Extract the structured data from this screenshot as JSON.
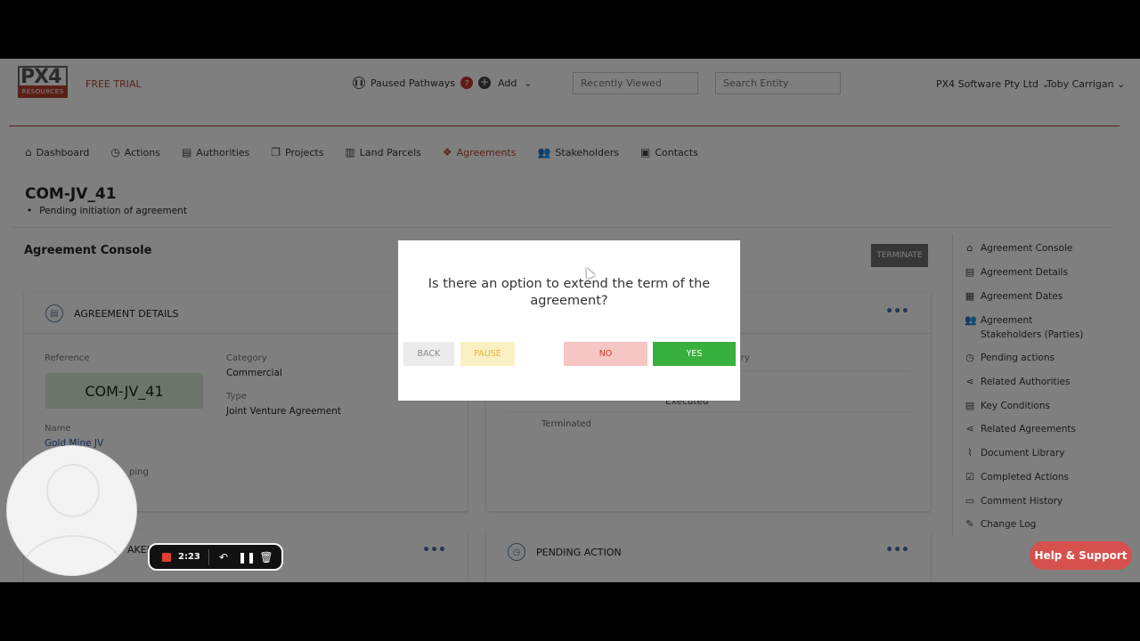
{
  "header": {
    "logo_mark": "PX4",
    "logo_sub": "RESOURCES",
    "free_trial": "FREE TRIAL",
    "paused_pathways_label": "Paused Pathways",
    "paused_count": "7",
    "add_label": "Add",
    "recently_viewed_placeholder": "Recently Viewed",
    "search_placeholder": "Search Entity",
    "org_name": "PX4 Software Pty Ltd",
    "user_name": "Toby Carrigan"
  },
  "nav": {
    "items": [
      {
        "label": "Dashboard",
        "icon": "home-icon"
      },
      {
        "label": "Actions",
        "icon": "clock-icon"
      },
      {
        "label": "Authorities",
        "icon": "document-icon"
      },
      {
        "label": "Projects",
        "icon": "files-icon"
      },
      {
        "label": "Land Parcels",
        "icon": "map-icon"
      },
      {
        "label": "Agreements",
        "icon": "handshake-icon",
        "active": true
      },
      {
        "label": "Stakeholders",
        "icon": "people-icon"
      },
      {
        "label": "Contacts",
        "icon": "contact-card-icon"
      }
    ]
  },
  "page": {
    "title": "COM-JV_41",
    "status": "Pending initiation of agreement",
    "console_heading": "Agreement Console",
    "terminate_label": "TERMINATE"
  },
  "agreement_details": {
    "heading": "AGREEMENT DETAILS",
    "reference_label": "Reference",
    "reference_value": "COM-JV_41",
    "category_label": "Category",
    "category_value": "Commercial",
    "type_label": "Type",
    "type_value": "Joint Venture Agreement",
    "name_label": "Name",
    "name_value": "Gold Mine JV",
    "partial_label": "ping"
  },
  "dates_card": {
    "partial_label": "iry",
    "executed_value": "Executed",
    "terminated_label": "Terminated"
  },
  "bottom_cards": {
    "stakeholders_heading": "AKEHO",
    "pending_heading": "PENDING ACTION"
  },
  "sidebar": {
    "items": [
      {
        "label": "Agreement Console",
        "icon": "home-icon"
      },
      {
        "label": "Agreement Details",
        "icon": "document-icon"
      },
      {
        "label": "Agreement Dates",
        "icon": "calendar-icon"
      },
      {
        "label": "Agreement Stakeholders (Parties)",
        "icon": "people-icon"
      },
      {
        "label": "Pending actions",
        "icon": "clock-icon"
      },
      {
        "label": "Related Authorities",
        "icon": "share-icon"
      },
      {
        "label": "Key Conditions",
        "icon": "list-icon"
      },
      {
        "label": "Related Agreements",
        "icon": "share-icon"
      },
      {
        "label": "Document Library",
        "icon": "paperclip-icon"
      },
      {
        "label": "Completed Actions",
        "icon": "checkbox-icon"
      },
      {
        "label": "Comment History",
        "icon": "comment-icon"
      },
      {
        "label": "Change Log",
        "icon": "pencil-icon"
      }
    ]
  },
  "modal": {
    "question": "Is there an option to extend the term of the agreement?",
    "back_label": "BACK",
    "pause_label": "PAUSE",
    "no_label": "NO",
    "yes_label": "YES"
  },
  "recorder": {
    "time": "2:23"
  },
  "help": {
    "label": "Help & Support"
  },
  "colors": {
    "brand": "#b5412b",
    "yes": "#38b03d",
    "no_bg": "#f5c6c2",
    "help": "#d6504e"
  }
}
